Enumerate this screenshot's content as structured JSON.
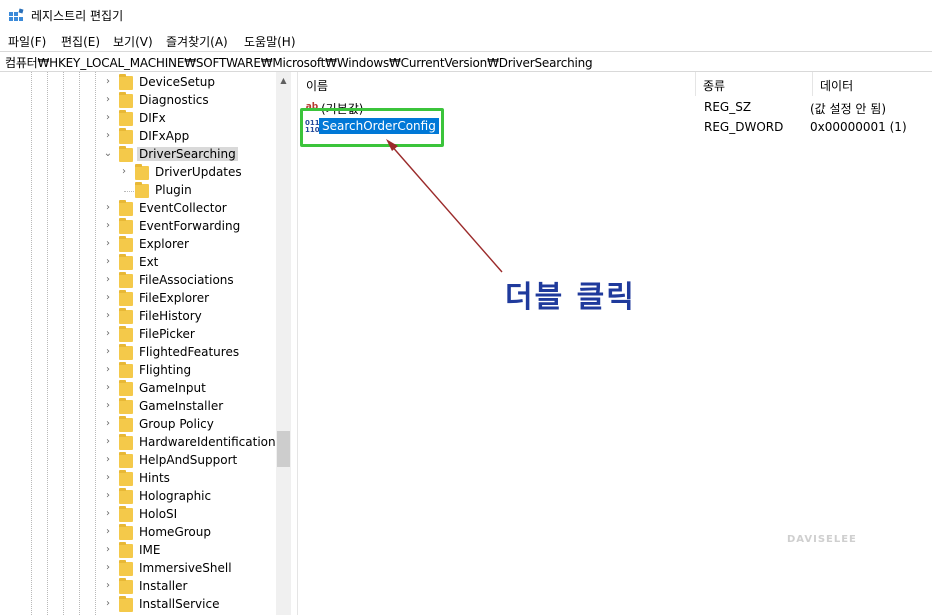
{
  "window": {
    "title": "레지스트리 편집기"
  },
  "menu": [
    "파일(F)",
    "편집(E)",
    "보기(V)",
    "즐겨찾기(A)",
    "도움말(H)"
  ],
  "address": "컴퓨터₩HKEY_LOCAL_MACHINE₩SOFTWARE₩Microsoft₩Windows₩CurrentVersion₩DriverSearching",
  "tree": {
    "items": [
      {
        "label": "DeviceSetup",
        "expandable": true
      },
      {
        "label": "Diagnostics",
        "expandable": true
      },
      {
        "label": "DIFx",
        "expandable": true
      },
      {
        "label": "DIFxApp",
        "expandable": true
      },
      {
        "label": "DriverSearching",
        "expandable": true,
        "expanded": true,
        "selected": true
      },
      {
        "label": "DriverUpdates",
        "expandable": true,
        "child": true
      },
      {
        "label": "Plugin",
        "expandable": false,
        "child": true
      },
      {
        "label": "EventCollector",
        "expandable": true
      },
      {
        "label": "EventForwarding",
        "expandable": true
      },
      {
        "label": "Explorer",
        "expandable": true
      },
      {
        "label": "Ext",
        "expandable": true
      },
      {
        "label": "FileAssociations",
        "expandable": true
      },
      {
        "label": "FileExplorer",
        "expandable": true
      },
      {
        "label": "FileHistory",
        "expandable": true
      },
      {
        "label": "FilePicker",
        "expandable": true
      },
      {
        "label": "FlightedFeatures",
        "expandable": true
      },
      {
        "label": "Flighting",
        "expandable": true
      },
      {
        "label": "GameInput",
        "expandable": true
      },
      {
        "label": "GameInstaller",
        "expandable": true
      },
      {
        "label": "Group Policy",
        "expandable": true
      },
      {
        "label": "HardwareIdentification",
        "expandable": true
      },
      {
        "label": "HelpAndSupport",
        "expandable": true
      },
      {
        "label": "Hints",
        "expandable": true
      },
      {
        "label": "Holographic",
        "expandable": true
      },
      {
        "label": "HoloSI",
        "expandable": true
      },
      {
        "label": "HomeGroup",
        "expandable": true
      },
      {
        "label": "IME",
        "expandable": true
      },
      {
        "label": "ImmersiveShell",
        "expandable": true
      },
      {
        "label": "Installer",
        "expandable": true
      },
      {
        "label": "InstallService",
        "expandable": true
      }
    ]
  },
  "list": {
    "columns": [
      "이름",
      "종류",
      "데이터"
    ],
    "rows": [
      {
        "icon": "string-value-icon",
        "icon_text": "ab",
        "name": "(기본값)",
        "type": "REG_SZ",
        "data": "(값 설정 안 됨)",
        "selected": false
      },
      {
        "icon": "dword-value-icon",
        "icon_text": "011\n110",
        "name": "SearchOrderConfig",
        "type": "REG_DWORD",
        "data": "0x00000001 (1)",
        "selected": true
      }
    ]
  },
  "annotation": {
    "text": "더블 클릭",
    "color": "#1f3a9c",
    "box_color": "#3bc43b",
    "arrow_color": "#9b2b2b"
  },
  "watermark": "DAVISELEE"
}
